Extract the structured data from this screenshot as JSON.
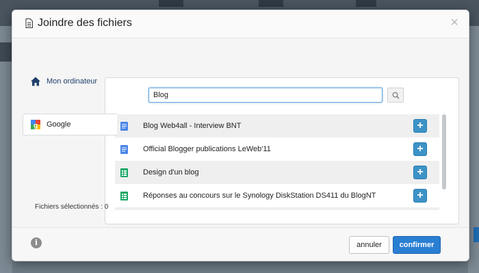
{
  "dialog": {
    "title": "Joindre des fichiers",
    "close_label": "×"
  },
  "sources": [
    {
      "label": "Mon ordinateur",
      "icon": "home-icon"
    },
    {
      "label": "Google",
      "icon": "google-icon"
    }
  ],
  "search": {
    "value": "Blog",
    "placeholder": ""
  },
  "files": [
    {
      "name": "Blog Web4all - Interview BNT",
      "type": "document",
      "icon_color": "#4a86e8"
    },
    {
      "name": "Official Blogger publications LeWeb'11",
      "type": "document",
      "icon_color": "#4a86e8"
    },
    {
      "name": "Design d'un blog",
      "type": "spreadsheet",
      "icon_color": "#16a765"
    },
    {
      "name": "Réponses au concours sur le Synology DiskStation DS411 du BlogNT",
      "type": "spreadsheet",
      "icon_color": "#16a765"
    }
  ],
  "add_label": "+",
  "selected_count_text": "Fichiers sélectionnés : 0",
  "footer": {
    "info_label": "i",
    "cancel_label": "annuler",
    "confirm_label": "confirmer"
  },
  "colors": {
    "accent": "#2a7fd3",
    "add_button": "#3d93c7"
  }
}
